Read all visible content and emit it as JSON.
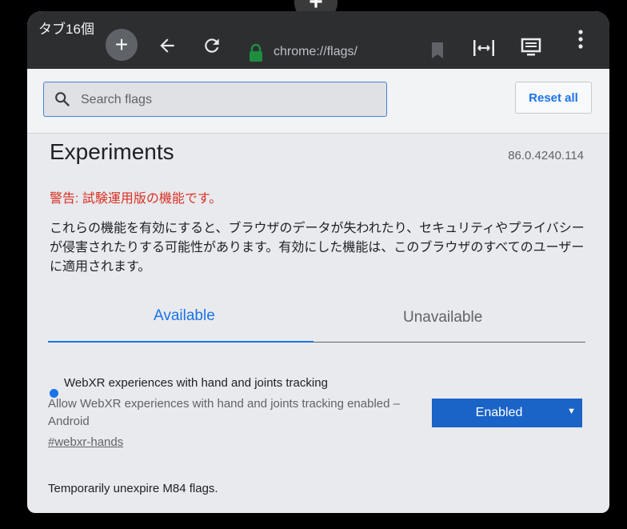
{
  "toolbar": {
    "tab_count": "タブ16個",
    "new_tab": "+",
    "url": "chrome://flags/"
  },
  "top_button": "+",
  "header": {
    "search_placeholder": "Search flags",
    "reset_label": "Reset all"
  },
  "page": {
    "title": "Experiments",
    "version": "86.0.4240.114",
    "warning": "警告: 試験運用版の機能です。",
    "description": "これらの機能を有効にすると、ブラウザのデータが失われたり、セキュリティやプライバシーが侵害されたりする可能性があります。有効にした機能は、このブラウザのすべてのユーザーに適用されます。"
  },
  "tabs": {
    "available": "Available",
    "unavailable": "Unavailable"
  },
  "flags": [
    {
      "name": "WebXR experiences with hand and joints tracking",
      "description": "Allow WebXR experiences with hand and joints tracking enabled – Android",
      "link": "#webxr-hands",
      "selected": "Enabled"
    },
    {
      "name": "Temporarily unexpire M84 flags."
    }
  ],
  "colors": {
    "accent": "#1a73e8",
    "warning": "#d93025",
    "toolbar": "#2d2e30"
  }
}
